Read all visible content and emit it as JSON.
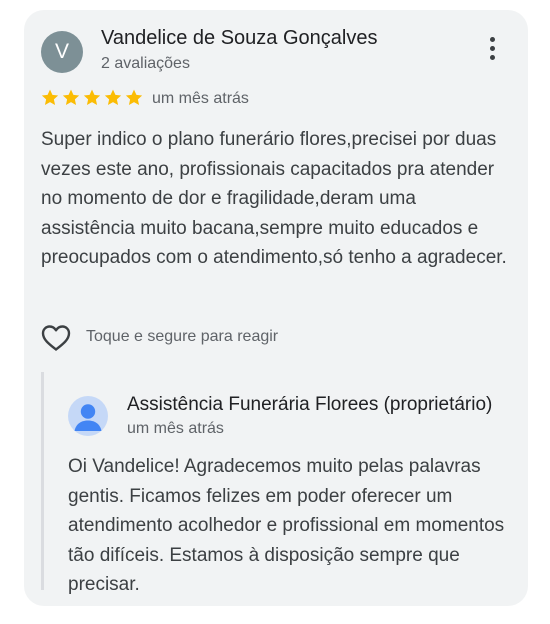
{
  "review": {
    "avatar_letter": "V",
    "reviewer_name": "Vandelice de Souza Gonçalves",
    "reviewer_meta": "2 avaliações",
    "rating": 5,
    "time": "um mês atrás",
    "text": "Super indico o plano funerário flores,precisei por duas vezes este ano, profissionais capacitados pra atender no momento de dor e fragilidade,deram uma assistência muito bacana,sempre muito educados e preocupados com o atendimento,só tenho a agradecer."
  },
  "reaction": {
    "label": "Toque e segure para reagir"
  },
  "owner_reply": {
    "name": "Assistência Funerária Florees (proprietário)",
    "time": "um mês atrás",
    "text": "Oi Vandelice! Agradecemos muito pelas palavras gentis. Ficamos felizes em poder oferecer um atendimento acolhedor e profissional em momentos tão difíceis. Estamos à disposição sempre que precisar."
  },
  "colors": {
    "card_background": "#f1f3f4",
    "star": "#fbbc04",
    "avatar": "#7d9096",
    "owner_avatar_fg": "#4285f4",
    "owner_avatar_bg": "#c5d8f7"
  },
  "icons": {
    "more": "more-vert-icon",
    "star": "star-icon",
    "heart": "heart-outline-icon",
    "owner_avatar": "person-icon"
  }
}
